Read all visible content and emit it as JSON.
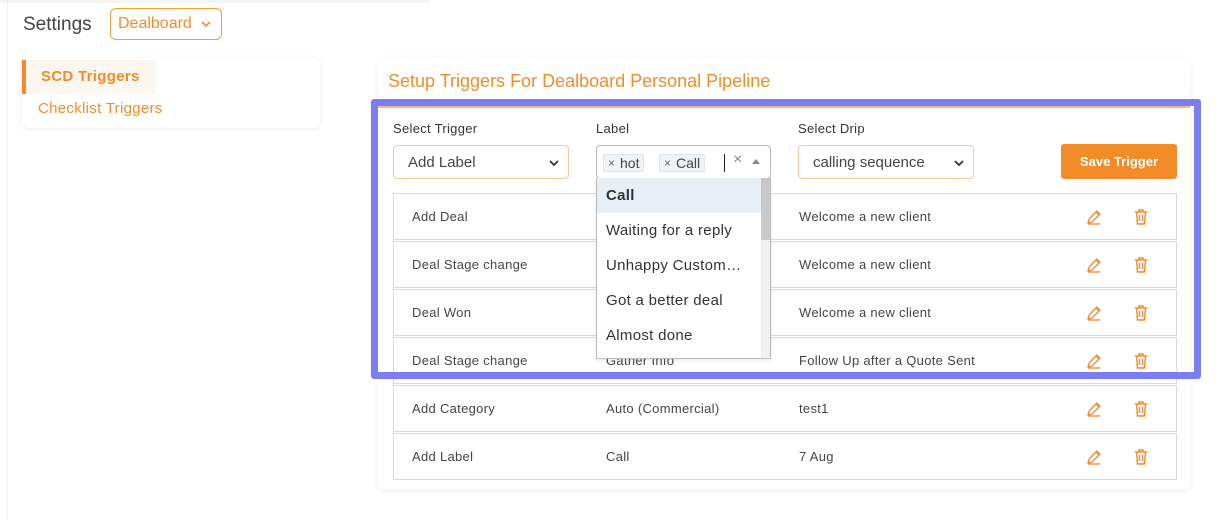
{
  "header": {
    "title": "Settings",
    "board_select": "Dealboard"
  },
  "sidebar": {
    "items": [
      {
        "label": "SCD Triggers",
        "active": true
      },
      {
        "label": "Checklist Triggers",
        "active": false
      }
    ]
  },
  "main": {
    "title": "Setup Triggers For Dealboard Personal Pipeline",
    "form": {
      "trigger_label": "Select Trigger",
      "trigger_value": "Add Label",
      "label_label": "Label",
      "label_tags": [
        "hot",
        "Call"
      ],
      "drip_label": "Select Drip",
      "drip_value": "calling sequence",
      "save_button": "Save Trigger"
    },
    "dropdown": {
      "options": [
        "Call",
        "Waiting for a reply",
        "Unhappy Custom…",
        "Got a better deal",
        "Almost done"
      ],
      "highlighted_index": 0
    },
    "table": {
      "rows": [
        {
          "trigger": "Add Deal",
          "label": "",
          "drip": "Welcome a new client"
        },
        {
          "trigger": "Deal Stage change",
          "label": "",
          "drip": "Welcome a new client"
        },
        {
          "trigger": "Deal Won",
          "label": "",
          "drip": "Welcome a new client"
        },
        {
          "trigger": "Deal Stage change",
          "label": "Gather Info",
          "drip": "Follow Up after a Quote Sent"
        },
        {
          "trigger": "Add Category",
          "label": "Auto (Commercial)",
          "drip": "test1"
        },
        {
          "trigger": "Add Label",
          "label": "Call",
          "drip": "7 Aug"
        }
      ]
    }
  },
  "colors": {
    "accent": "#f28c28",
    "annotation": "#7b7ef0"
  },
  "icons": {
    "edit": "pencil-icon",
    "delete": "trash-icon",
    "chevron": "chevron-down-icon"
  }
}
